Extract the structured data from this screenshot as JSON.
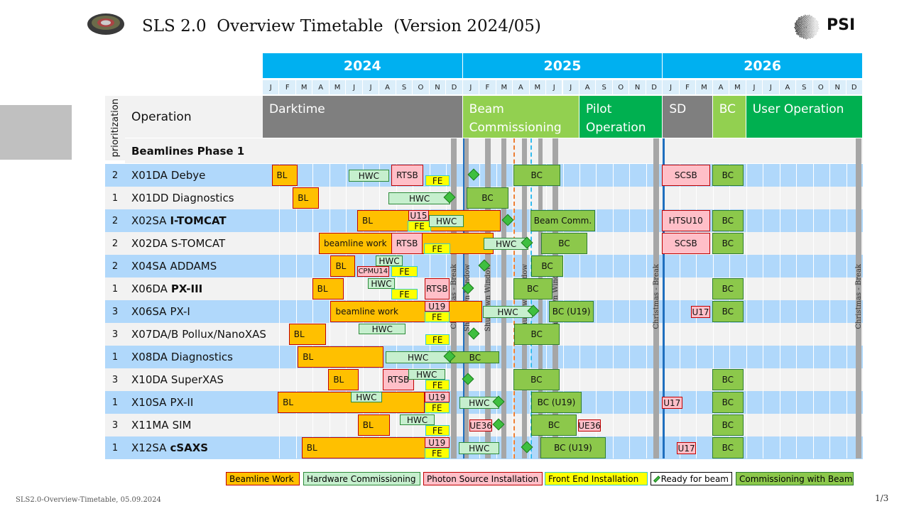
{
  "header": {
    "title": "SLS 2.0  Overview Timetable  (Version 2024/05)",
    "logo_text": "PSI"
  },
  "years": [
    "2024",
    "2025",
    "2026"
  ],
  "months": [
    "J",
    "F",
    "M",
    "A",
    "M",
    "J",
    "J",
    "A",
    "S",
    "O",
    "N",
    "D"
  ],
  "colors": {
    "year": "#00b0f0",
    "darktime": "#7f7f7f",
    "beam_comm": "#92d050",
    "operation": "#00b050",
    "row_blue": "#b0d8fb",
    "row_grey": "#f2f2f2",
    "BL": "#ffc000",
    "HWC": "#c6efce",
    "PS": "#ffbfc8",
    "FE": "#ffff00",
    "BC": "#8cc84b"
  },
  "table": {
    "prio_header": "prioritization",
    "op_header": "Operation",
    "section": "Beamlines Phase 1"
  },
  "chart_data": {
    "type": "gantt",
    "x_axis": {
      "type": "date",
      "range": [
        "2024-01-01",
        "2027-01-01"
      ]
    },
    "operation": [
      {
        "label": "Darktime",
        "start": "2024-01-01",
        "end": "2025-01-01",
        "color": "#7f7f7f",
        "text": "#fff"
      },
      {
        "label": "Beam Commissioning",
        "start": "2025-01-01",
        "end": "2025-08-01",
        "color": "#92d050",
        "text": "#fff"
      },
      {
        "label": "Pilot Operation",
        "start": "2025-08-01",
        "end": "2026-01-01",
        "color": "#00b050",
        "text": "#fff"
      },
      {
        "label": "SD",
        "start": "2026-01-01",
        "end": "2026-04-01",
        "color": "#7f7f7f",
        "text": "#fff"
      },
      {
        "label": "BC",
        "start": "2026-04-01",
        "end": "2026-06-01",
        "color": "#92d050",
        "text": "#fff"
      },
      {
        "label": "User Operation",
        "start": "2026-06-01",
        "end": "2027-01-01",
        "color": "#00b050",
        "text": "#fff"
      }
    ],
    "markers": [
      {
        "kind": "grey",
        "start": "2024-12-10",
        "end": "2024-12-20",
        "label": "Christmas - Break"
      },
      {
        "kind": "blue",
        "date": "2025-01-01"
      },
      {
        "kind": "grey",
        "start": "2025-01-04",
        "end": "2025-01-12",
        "label": "Shutdown Window"
      },
      {
        "kind": "grey",
        "start": "2025-02-11",
        "end": "2025-02-21",
        "label": "Shutdown Window"
      },
      {
        "kind": "grey",
        "start": "2025-03-11",
        "end": "2025-03-19",
        "label": ""
      },
      {
        "kind": "grey",
        "start": "2025-04-17",
        "end": "2025-04-26",
        "label": "Shutdown Window"
      },
      {
        "kind": "grey",
        "start": "2025-05-17",
        "end": "2025-05-25",
        "label": ""
      },
      {
        "kind": "grey",
        "start": "2025-06-12",
        "end": "2025-06-23",
        "label": "Shutdown Window"
      },
      {
        "kind": "orange-dash",
        "date": "2025-04-02"
      },
      {
        "kind": "cyan-dash",
        "date": "2025-05-03"
      },
      {
        "kind": "grey",
        "start": "2025-12-14",
        "end": "2025-12-24",
        "label": "Christmas - Break"
      },
      {
        "kind": "blue",
        "date": "2026-01-01"
      },
      {
        "kind": "grey",
        "start": "2026-12-18",
        "end": "2026-12-28",
        "label": "Christmas - Break"
      }
    ],
    "rows": [
      {
        "prio": "2",
        "code": "X01DA",
        "name": "Debye",
        "bold": false,
        "tasks": [
          {
            "t": "BL",
            "label": "BL",
            "start": "2024-01-17",
            "end": "2024-03-04",
            "pos": "full"
          },
          {
            "t": "HWC",
            "label": "HWC",
            "start": "2024-06-06",
            "end": "2024-08-18",
            "pos": "mid"
          },
          {
            "t": "PS",
            "label": "RTSB",
            "start": "2024-08-22",
            "end": "2024-10-20",
            "pos": "full"
          },
          {
            "t": "FE",
            "label": "FE",
            "start": "2024-10-24",
            "end": "2024-12-07",
            "pos": "bottom"
          },
          {
            "t": "RFB",
            "date": "2025-01-22"
          },
          {
            "t": "BC",
            "label": "BC",
            "start": "2025-04-02",
            "end": "2025-06-26",
            "pos": "full"
          },
          {
            "t": "PS",
            "label": "SCSB",
            "start": "2025-12-29",
            "end": "2026-03-26",
            "pos": "full"
          },
          {
            "t": "BC",
            "label": "BC",
            "start": "2026-03-30",
            "end": "2026-05-26",
            "pos": "full"
          }
        ]
      },
      {
        "prio": "1",
        "code": "X01DD",
        "name": "Diagnostics",
        "bold": false,
        "tasks": [
          {
            "t": "BL",
            "label": "BL",
            "start": "2024-02-25",
            "end": "2024-04-12",
            "pos": "full"
          },
          {
            "t": "HWC",
            "label": "HWC",
            "start": "2024-08-17",
            "end": "2024-12-09",
            "pos": "mid"
          },
          {
            "t": "RFB",
            "date": "2024-12-09"
          },
          {
            "t": "BC",
            "label": "BC",
            "start": "2025-01-08",
            "end": "2025-03-23",
            "pos": "full"
          }
        ]
      },
      {
        "prio": "2",
        "code": "X02SA",
        "name": "I-TOMCAT",
        "bold": true,
        "tasks": [
          {
            "t": "BL",
            "label": "BL",
            "start": "2024-06-21",
            "end": "2025-03-09",
            "pos": "full"
          },
          {
            "t": "PS",
            "label": "U15",
            "start": "2024-09-23",
            "end": "2024-10-30",
            "pos": "top"
          },
          {
            "t": "FE",
            "label": "FE",
            "start": "2024-09-22",
            "end": "2024-11-04",
            "pos": "bottom"
          },
          {
            "t": "HWC",
            "label": "HWC",
            "start": "2024-10-30",
            "end": "2025-01-03",
            "pos": "mid"
          },
          {
            "t": "RFB",
            "date": "2025-03-23"
          },
          {
            "t": "BC",
            "label": "Beam Comm.",
            "start": "2025-05-03",
            "end": "2025-08-29",
            "pos": "full"
          },
          {
            "t": "PS",
            "label": "HTSU10",
            "start": "2025-12-29",
            "end": "2026-03-26",
            "pos": "full"
          },
          {
            "t": "BC",
            "label": "BC",
            "start": "2026-03-30",
            "end": "2026-05-26",
            "pos": "full"
          }
        ]
      },
      {
        "prio": "2",
        "code": "X02DA",
        "name": "S-TOMCAT",
        "bold": false,
        "tasks": [
          {
            "t": "BL",
            "label": "beamline work",
            "start": "2024-04-12",
            "end": "2025-02-26",
            "pos": "full"
          },
          {
            "t": "PS",
            "label": "RTSB",
            "start": "2024-08-22",
            "end": "2024-10-19",
            "pos": "full"
          },
          {
            "t": "FE",
            "label": "FE",
            "start": "2024-10-21",
            "end": "2024-12-09",
            "pos": "bottom"
          },
          {
            "t": "HWC",
            "label": "HWC",
            "start": "2025-02-09",
            "end": "2025-04-29",
            "pos": "mid"
          },
          {
            "t": "RFB",
            "date": "2025-04-28"
          },
          {
            "t": "BC",
            "label": "BC",
            "start": "2025-05-22",
            "end": "2025-08-15",
            "pos": "full"
          },
          {
            "t": "PS",
            "label": "SCSB",
            "start": "2025-12-29",
            "end": "2026-03-26",
            "pos": "full"
          },
          {
            "t": "BC",
            "label": "BC",
            "start": "2026-03-30",
            "end": "2026-05-26",
            "pos": "full"
          }
        ]
      },
      {
        "prio": "2",
        "code": "X04SA",
        "name": "ADDAMS",
        "bold": false,
        "tasks": [
          {
            "t": "BL",
            "label": "BL",
            "start": "2024-05-03",
            "end": "2024-06-17",
            "pos": "full"
          },
          {
            "t": "HWC",
            "label": "HWC",
            "start": "2024-07-24",
            "end": "2024-09-13",
            "pos": "top"
          },
          {
            "t": "PS",
            "label": "CPMU14",
            "start": "2024-06-21",
            "end": "2024-08-18",
            "pos": "bottom"
          },
          {
            "t": "FE",
            "label": "FE",
            "start": "2024-08-22",
            "end": "2024-10-10",
            "pos": "bottom"
          },
          {
            "t": "RFB",
            "date": "2025-02-11"
          },
          {
            "t": "BC",
            "label": "BC",
            "start": "2025-05-04",
            "end": "2025-07-02",
            "pos": "full"
          }
        ]
      },
      {
        "prio": "1",
        "code": "X06DA",
        "name": "PX-III",
        "bold": true,
        "tasks": [
          {
            "t": "BL",
            "label": "BL",
            "start": "2024-03-30",
            "end": "2024-05-27",
            "pos": "full"
          },
          {
            "t": "HWC",
            "label": "HWC",
            "start": "2024-07-10",
            "end": "2024-08-29",
            "pos": "top"
          },
          {
            "t": "FE",
            "label": "FE",
            "start": "2024-08-22",
            "end": "2024-10-10",
            "pos": "bottom"
          },
          {
            "t": "PS",
            "label": "RTSB",
            "start": "2024-10-22",
            "end": "2024-12-07",
            "pos": "full"
          },
          {
            "t": "RFB",
            "date": "2025-01-12"
          },
          {
            "t": "BC",
            "label": "BC",
            "start": "2025-04-02",
            "end": "2025-06-12",
            "pos": "full"
          },
          {
            "t": "BC",
            "label": "BC",
            "start": "2026-03-30",
            "end": "2026-05-26",
            "pos": "full"
          }
        ]
      },
      {
        "prio": "3",
        "code": "X06SA",
        "name": "PX-I",
        "bold": false,
        "tasks": [
          {
            "t": "BL",
            "label": "beamline work",
            "start": "2024-05-03",
            "end": "2025-02-06",
            "pos": "full"
          },
          {
            "t": "PS",
            "label": "U19",
            "start": "2024-10-22",
            "end": "2024-12-07",
            "pos": "top"
          },
          {
            "t": "FE",
            "label": "FE",
            "start": "2024-10-22",
            "end": "2024-12-07",
            "pos": "bottom"
          },
          {
            "t": "HWC",
            "label": "HWC",
            "start": "2025-02-07",
            "end": "2025-05-07",
            "pos": "mid"
          },
          {
            "t": "RFB",
            "date": "2025-05-09"
          },
          {
            "t": "BC",
            "label": "BC (U19)",
            "start": "2025-06-06",
            "end": "2025-08-27",
            "pos": "full"
          },
          {
            "t": "PS",
            "label": "U17",
            "start": "2026-02-22",
            "end": "2026-03-26",
            "pos": "mid"
          },
          {
            "t": "BC",
            "label": "BC",
            "start": "2026-03-30",
            "end": "2026-05-26",
            "pos": "full"
          }
        ]
      },
      {
        "prio": "3",
        "code": "X07DA/B",
        "name": "Pollux/NanoXAS",
        "bold": false,
        "tasks": [
          {
            "t": "BL",
            "label": "BL",
            "start": "2024-02-18",
            "end": "2024-04-25",
            "pos": "full"
          },
          {
            "t": "HWC",
            "label": "HWC",
            "start": "2024-06-24",
            "end": "2024-09-18",
            "pos": "top"
          },
          {
            "t": "FE",
            "label": "FE",
            "start": "2024-10-24",
            "end": "2024-12-07",
            "pos": "bottom"
          },
          {
            "t": "RFB",
            "date": "2025-01-22"
          },
          {
            "t": "BC",
            "label": "BC",
            "start": "2025-04-03",
            "end": "2025-06-25",
            "pos": "full"
          }
        ]
      },
      {
        "prio": "1",
        "code": "X08DA",
        "name": "Diagnostics",
        "bold": false,
        "tasks": [
          {
            "t": "BL",
            "label": "BL",
            "start": "2024-03-04",
            "end": "2024-08-08",
            "pos": "full"
          },
          {
            "t": "HWC",
            "label": "HWC",
            "start": "2024-08-12",
            "end": "2024-12-09",
            "pos": "mid"
          },
          {
            "t": "BC",
            "label": "BC",
            "start": "2024-12-09",
            "end": "2025-03-07",
            "pos": "mid"
          },
          {
            "t": "RFB",
            "date": "2024-12-09"
          }
        ]
      },
      {
        "prio": "3",
        "code": "X10DA",
        "name": "SuperXAS",
        "bold": false,
        "tasks": [
          {
            "t": "BL",
            "label": "BL",
            "start": "2024-04-29",
            "end": "2024-06-24",
            "pos": "full"
          },
          {
            "t": "PS",
            "label": "RTSB",
            "start": "2024-08-07",
            "end": "2024-10-03",
            "pos": "full"
          },
          {
            "t": "HWC",
            "label": "HWC",
            "start": "2024-09-23",
            "end": "2024-11-29",
            "pos": "top"
          },
          {
            "t": "FE",
            "label": "FE",
            "start": "2024-10-24",
            "end": "2024-12-07",
            "pos": "bottom"
          },
          {
            "t": "RFB",
            "date": "2025-01-12"
          },
          {
            "t": "BC",
            "label": "BC",
            "start": "2025-04-02",
            "end": "2025-06-25",
            "pos": "full"
          },
          {
            "t": "BC",
            "label": "BC",
            "start": "2026-03-30",
            "end": "2026-05-26",
            "pos": "full"
          }
        ]
      },
      {
        "prio": "1",
        "code": "X10SA",
        "name": "PX-II",
        "bold": false,
        "tasks": [
          {
            "t": "BL",
            "label": "BL",
            "start": "2024-01-28",
            "end": "2024-10-22",
            "pos": "full"
          },
          {
            "t": "HWC",
            "label": "HWC",
            "start": "2024-06-09",
            "end": "2024-08-06",
            "pos": "top"
          },
          {
            "t": "PS",
            "label": "U19",
            "start": "2024-10-22",
            "end": "2024-12-07",
            "pos": "top"
          },
          {
            "t": "FE",
            "label": "FE",
            "start": "2024-10-22",
            "end": "2024-12-07",
            "pos": "bottom"
          },
          {
            "t": "HWC",
            "label": "HWC",
            "start": "2024-12-25",
            "end": "2025-03-06",
            "pos": "mid"
          },
          {
            "t": "RFB",
            "date": "2025-03-07"
          },
          {
            "t": "BC",
            "label": "BC (U19)",
            "start": "2025-05-04",
            "end": "2025-08-05",
            "pos": "full"
          },
          {
            "t": "PS",
            "label": "U17",
            "start": "2025-12-29",
            "end": "2026-02-06",
            "pos": "mid"
          },
          {
            "t": "BC",
            "label": "BC",
            "start": "2026-03-30",
            "end": "2026-05-26",
            "pos": "full"
          }
        ]
      },
      {
        "prio": "3",
        "code": "X11MA",
        "name": "SIM",
        "bold": false,
        "tasks": [
          {
            "t": "BL",
            "label": "BL",
            "start": "2024-06-22",
            "end": "2024-08-20",
            "pos": "full"
          },
          {
            "t": "HWC",
            "label": "HWC",
            "start": "2024-09-08",
            "end": "2024-11-10",
            "pos": "top"
          },
          {
            "t": "FE",
            "label": "FE",
            "start": "2024-10-24",
            "end": "2024-12-07",
            "pos": "bottom"
          },
          {
            "t": "PS",
            "label": "UE36",
            "start": "2025-01-13",
            "end": "2025-02-24",
            "pos": "mid"
          },
          {
            "t": "RFB",
            "date": "2025-03-07"
          },
          {
            "t": "BC",
            "label": "BC",
            "start": "2025-05-04",
            "end": "2025-07-26",
            "pos": "full"
          },
          {
            "t": "PS",
            "label": "UE36",
            "start": "2025-07-29",
            "end": "2025-09-09",
            "pos": "mid"
          },
          {
            "t": "BC",
            "label": "BC",
            "start": "2026-03-30",
            "end": "2026-05-26",
            "pos": "full"
          }
        ]
      },
      {
        "prio": "1",
        "code": "X12SA",
        "name": "cSAXS",
        "bold": true,
        "tasks": [
          {
            "t": "BL",
            "label": "BL",
            "start": "2024-03-11",
            "end": "2024-12-07",
            "pos": "full"
          },
          {
            "t": "PS",
            "label": "U19",
            "start": "2024-10-22",
            "end": "2024-12-07",
            "pos": "top"
          },
          {
            "t": "FE",
            "label": "FE",
            "start": "2024-10-22",
            "end": "2024-12-07",
            "pos": "bottom"
          },
          {
            "t": "HWC",
            "label": "HWC",
            "start": "2024-12-24",
            "end": "2025-03-07",
            "pos": "mid"
          },
          {
            "t": "RFB",
            "date": "2025-04-28"
          },
          {
            "t": "BC",
            "label": "BC (U19)",
            "start": "2025-05-21",
            "end": "2025-09-18",
            "pos": "full"
          },
          {
            "t": "PS",
            "label": "U17",
            "start": "2026-01-26",
            "end": "2026-03-01",
            "pos": "mid"
          },
          {
            "t": "BC",
            "label": "BC",
            "start": "2026-03-30",
            "end": "2026-05-26",
            "pos": "full"
          }
        ]
      }
    ],
    "legend": [
      {
        "t": "BL",
        "label": "Beamline Work"
      },
      {
        "t": "HWC",
        "label": "Hardware Commissioning"
      },
      {
        "t": "PS",
        "label": "Photon Source Installation"
      },
      {
        "t": "FE",
        "label": "Front End Installation"
      },
      {
        "t": "RFB",
        "label": "Ready for beam"
      },
      {
        "t": "BC",
        "label": "Commissioning with Beam"
      }
    ]
  },
  "footer": {
    "left": "SLS2.0-Overview-Timetable, 05.09.2024",
    "page": "1/3"
  }
}
